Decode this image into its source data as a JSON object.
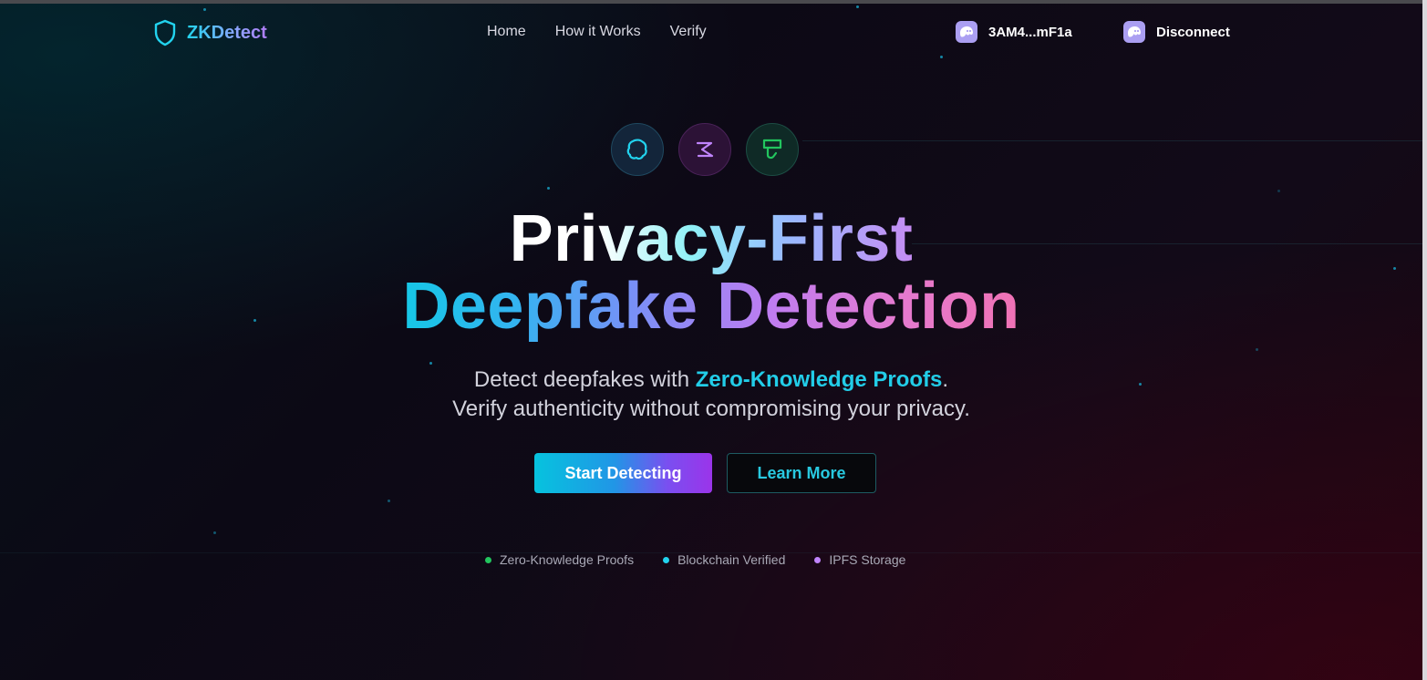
{
  "brand": {
    "name": "ZKDetect"
  },
  "nav": {
    "links": [
      "Home",
      "How it Works",
      "Verify"
    ],
    "wallet_address": "3AM4...mF1a",
    "disconnect_label": "Disconnect"
  },
  "hero": {
    "title_line1": "Privacy-First",
    "title_line2": "Deepfake Detection",
    "subtitle_prefix": "Detect deepfakes with ",
    "subtitle_highlight": "Zero-Knowledge Proofs",
    "subtitle_suffix": ".",
    "subtitle_line2": "Verify authenticity without compromising your privacy.",
    "icons": [
      "brain-icon",
      "zap-icon",
      "shield-icon"
    ]
  },
  "buttons": {
    "primary": "Start Detecting",
    "secondary": "Learn More"
  },
  "features": [
    {
      "label": "Zero-Knowledge Proofs",
      "color": "#22c55e"
    },
    {
      "label": "Blockchain Verified",
      "color": "#22d3ee"
    },
    {
      "label": "IPFS Storage",
      "color": "#c084fc"
    }
  ],
  "colors": {
    "accent_cyan": "#22d3ee",
    "accent_purple": "#a855f7",
    "accent_pink": "#f472b6",
    "wallet_icon": "#ab9ff2"
  }
}
